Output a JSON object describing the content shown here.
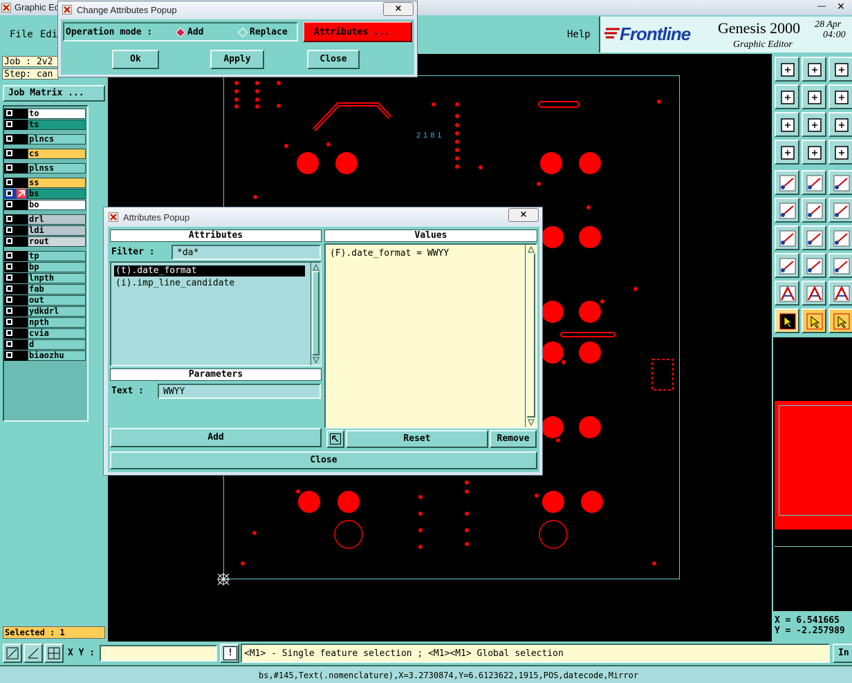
{
  "main_window": {
    "title": "Graphic Edit",
    "menu": [
      "File",
      "Edit",
      "Help"
    ],
    "job_label": "Job : 2v2",
    "step_label": "Step: can",
    "job_matrix_label": "Job Matrix ...",
    "brand": {
      "logo": "Frontline",
      "product": "Genesis 2000",
      "subtitle": "Graphic Editor",
      "date_line1": "28 Apr",
      "date_line2": "04:00"
    },
    "close_glyph": "×",
    "minimize_glyph": "—"
  },
  "layers": [
    {
      "name": "to",
      "color": "#ffffff"
    },
    {
      "name": "ts",
      "color": "#1a9a80"
    },
    {
      "name": "plncs",
      "color": "#7fd3c9"
    },
    {
      "name": "cs",
      "color": "#ffcc55"
    },
    {
      "name": "plnss",
      "color": "#7fd3c9"
    },
    {
      "name": "ss",
      "color": "#ffcc55"
    },
    {
      "name": "bs",
      "color": "#1a9a80"
    },
    {
      "name": "bo",
      "color": "#ffffff"
    },
    {
      "name": "drl",
      "color": "#b8c6cc"
    },
    {
      "name": "ldi",
      "color": "#b8c6cc"
    },
    {
      "name": "rout",
      "color": "#cfd6da"
    },
    {
      "name": "tp",
      "color": "#7fd3c9"
    },
    {
      "name": "bp",
      "color": "#7fd3c9"
    },
    {
      "name": "lnpth",
      "color": "#7fd3c9"
    },
    {
      "name": "fab",
      "color": "#7fd3c9"
    },
    {
      "name": "out",
      "color": "#7fd3c9"
    },
    {
      "name": "ydkdrl",
      "color": "#7fd3c9"
    },
    {
      "name": "npth",
      "color": "#7fd3c9"
    },
    {
      "name": "cvia",
      "color": "#7fd3c9"
    },
    {
      "name": "d",
      "color": "#7fd3c9"
    },
    {
      "name": "biaozhu",
      "color": "#7fd3c9"
    }
  ],
  "selected_label": "Selected : 1",
  "change_popup": {
    "title": "Change Attributes Popup",
    "operation_mode_label": "Operation mode :",
    "mode_add": "Add",
    "mode_replace": "Replace",
    "attributes_button": "Attributes ...",
    "ok": "Ok",
    "apply": "Apply",
    "close": "Close",
    "selected_mode": "Add"
  },
  "attr_popup": {
    "title": "Attributes Popup",
    "attributes_header": "Attributes",
    "values_header": "Values",
    "filter_label": "Filter :",
    "filter_value": "*da*",
    "attribute_items": [
      "(t).date_format",
      "(i).imp_line_candidate"
    ],
    "selected_index": 0,
    "values_items": [
      "(F).date_format = WWYY"
    ],
    "parameters_header": "Parameters",
    "text_label": "Text :",
    "text_value": "WWYY",
    "add_button": "Add",
    "reset_button": "Reset",
    "remove_button": "Remove",
    "close_button": "Close"
  },
  "canvas": {
    "label_text": "2181"
  },
  "coords": {
    "x_line": "X = 6.541665",
    "y_line": "Y = -2.257989"
  },
  "bottom": {
    "xy_label": "X Y :",
    "xy_value": "",
    "hint": "<M1> - Single feature selection ; <M1><M1> Global selection",
    "right_button": "In",
    "status": "bs,#145,Text(.nomenclature),X=3.2730874,Y=6.6123622,1915,POS,datecode,Mirror"
  },
  "colors": {
    "teal": "#7fd3c9",
    "feature_red": "#ff0000",
    "board_outline": "#5fd0d0",
    "values_bg": "#fffbd0",
    "attributes_red": "#ff0000"
  }
}
